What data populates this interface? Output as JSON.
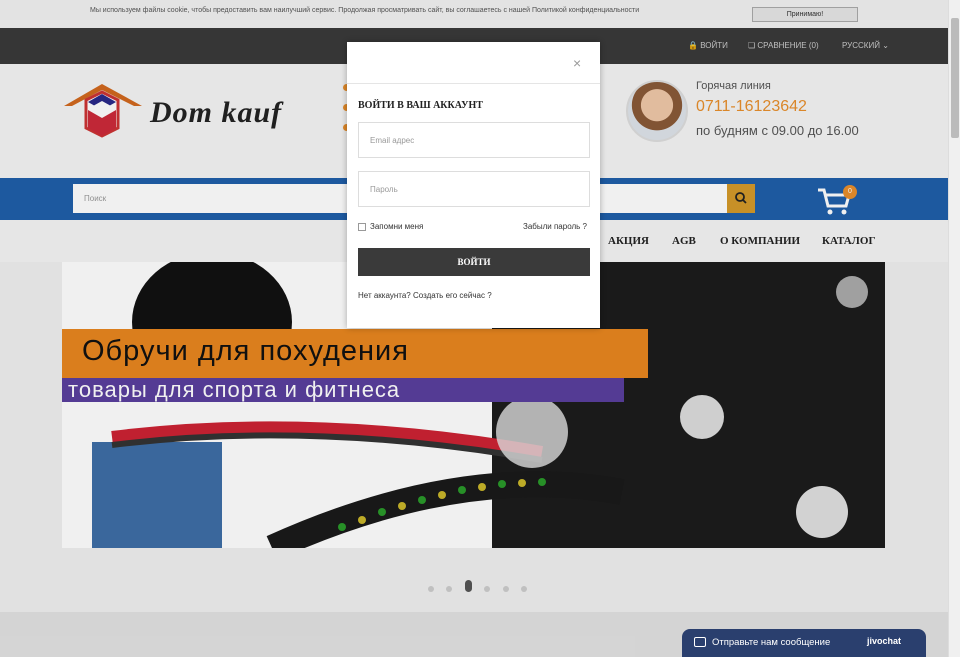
{
  "cookie": {
    "text": "Мы используем файлы cookie, чтобы предоставить вам наилучший сервис. Продолжая просматривать сайт, вы соглашаетесь с нашей Политикой конфиденциальности",
    "accept_label": "Принимаю!"
  },
  "topbar": {
    "login_label": "ВОЙТИ",
    "compare_label": "СРАВНЕНИЕ (0)",
    "language_label": "РУССКИЙ"
  },
  "header": {
    "logo_text": "Dom kauf",
    "hotline_title": "Горячая линия",
    "hotline_phone": "0711-16123642",
    "hotline_hours": "по будням с 09.00 до 16.00"
  },
  "search": {
    "placeholder": "Поиск"
  },
  "cart": {
    "count": "0"
  },
  "nav": {
    "items": [
      "АКЦИЯ",
      "AGB",
      "О КОМПАНИИ",
      "КАТАЛОГ"
    ]
  },
  "hero": {
    "headline": "Обручи для похудения",
    "subheadline": "товары для спорта и фитнеса"
  },
  "modal": {
    "close_symbol": "×",
    "title": "ВОЙТИ В ВАШ АККАУНТ",
    "email_placeholder": "Email адрес",
    "password_placeholder": "Пароль",
    "remember_label": "Запомни меня",
    "forgot_label": "Забыли пароль ?",
    "submit_label": "ВОЙТИ",
    "register_label": "Нет аккаунта? Создать его сейчас ?"
  },
  "chat": {
    "label": "Отправьте нам сообщение",
    "brand": "jivochat"
  },
  "colors": {
    "accent_orange": "#e88f2c",
    "nav_blue": "#1f5fa9",
    "dark_bar": "#3a3a3a"
  }
}
